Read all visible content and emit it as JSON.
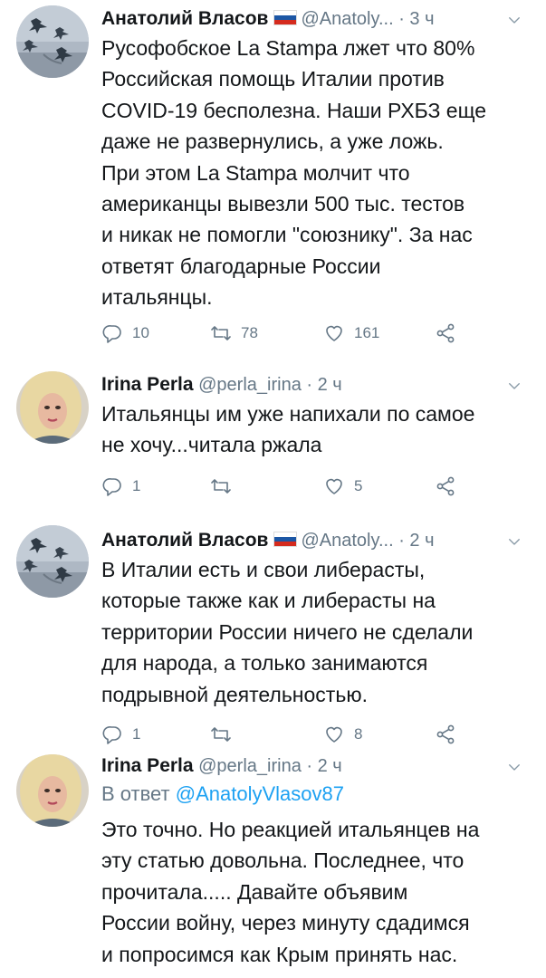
{
  "tweets": [
    {
      "name": "Анатолий Власов",
      "handle": "@Anatoly...",
      "time": "· 3 ч",
      "reply_prefix": "",
      "reply_to": "",
      "text": "Русофобское La Stampa лжет что 80%\nРоссийская помощь Италии против\nCOVID-19 бесполезна. Наши РХБЗ еще\nдаже не развернулись, а уже ложь.\nПри этом La Stampa молчит что\nамериканцы вывезли 500 тыс. тестов\nи никак не помогли \"союзнику\". За нас\nответят благодарные России\nитальянцы.",
      "replies": "10",
      "retweets": "78",
      "likes": "161"
    },
    {
      "name": "Irina Perla",
      "handle": "@perla_irina",
      "time": "· 2 ч",
      "reply_prefix": "",
      "reply_to": "",
      "text": "Итальянцы им уже напихали по самое\nне хочу...читала ржала",
      "replies": "1",
      "retweets": "",
      "likes": "5"
    },
    {
      "name": "Анатолий Власов",
      "handle": "@Anatoly...",
      "time": "· 2 ч",
      "reply_prefix": "",
      "reply_to": "",
      "text": "В Италии есть и свои либерасты,\nкоторые также как и либерасты на\nтерритории России ничего не сделали\nдля народа, а только занимаются\nподрывной деятельностью.",
      "replies": "1",
      "retweets": "",
      "likes": "8"
    },
    {
      "name": "Irina Perla",
      "handle": "@perla_irina",
      "time": "· 2 ч",
      "reply_prefix": "В ответ",
      "reply_to": "@AnatolyVlasov87",
      "text": "Это точно. Но реакцией итальянцев на\nэту статью довольна. Последнее, что\nпрочитала..... Давайте объявим\nРоссии войну, через минуту сдадимся\nи попросимся как Крым принять нас.",
      "replies": "",
      "retweets": "",
      "likes": ""
    }
  ],
  "colors": {
    "text": "#14171a",
    "muted": "#657786",
    "link": "#1da1f2"
  },
  "icons": [
    "reply-icon",
    "retweet-icon",
    "like-icon",
    "share-icon",
    "caret-down-icon",
    "russian-flag-icon"
  ]
}
